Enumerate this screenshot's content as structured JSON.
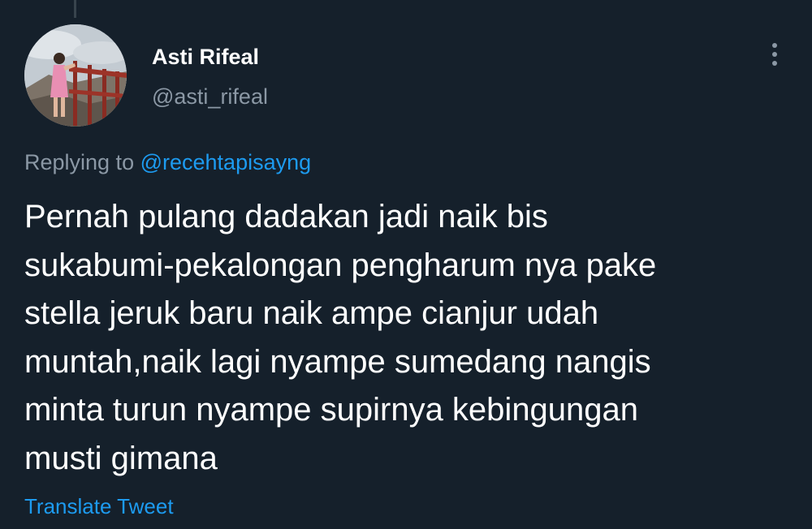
{
  "tweet": {
    "author": {
      "display_name": "Asti Rifeal",
      "handle": "@asti_rifeal",
      "avatar_icon": "profile-photo"
    },
    "more_icon": "more-vertical-icon",
    "reply_context": {
      "prefix": "Replying to",
      "mention": "@recehtapisayng"
    },
    "text": "Pernah pulang dadakan jadi naik bis\nsukabumi-pekalongan pengharum nya pake\nstella jeruk baru naik ampe cianjur udah\nmuntah,naik lagi nyampe sumedang nangis\nminta turun nyampe supirnya kebingungan\nmusti gimana",
    "translate_label": "Translate Tweet"
  },
  "colors": {
    "background": "#15202b",
    "primary_text": "#ffffff",
    "secondary_text": "#8b98a5",
    "accent": "#1d9bf0"
  }
}
